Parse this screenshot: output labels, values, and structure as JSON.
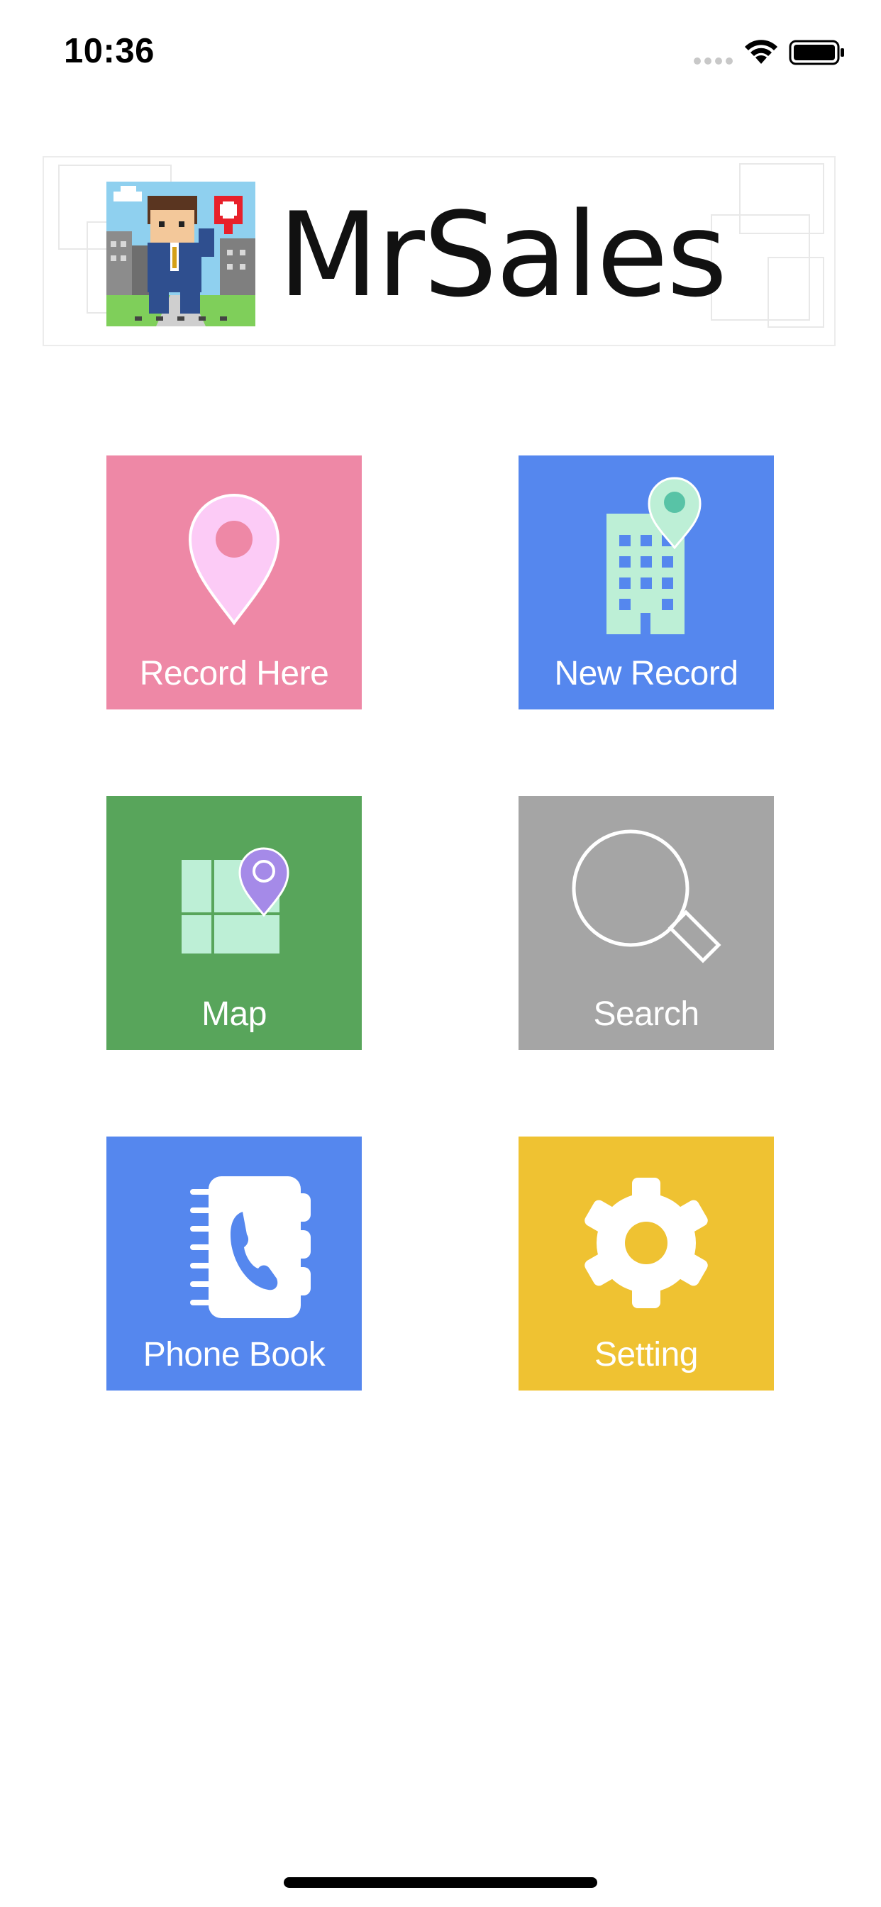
{
  "status_bar": {
    "time": "10:36"
  },
  "logo": {
    "text": "MrSales"
  },
  "tiles": [
    {
      "label": "Record Here",
      "icon": "location-pin-icon",
      "color": "#EE88A6"
    },
    {
      "label": "New Record",
      "icon": "building-pin-icon",
      "color": "#5587EE"
    },
    {
      "label": "Map",
      "icon": "map-pin-icon",
      "color": "#58A55B"
    },
    {
      "label": "Search",
      "icon": "magnifier-icon",
      "color": "#A5A5A5"
    },
    {
      "label": "Phone Book",
      "icon": "phone-book-icon",
      "color": "#5587EE"
    },
    {
      "label": "Setting",
      "icon": "gear-icon",
      "color": "#EFC232"
    }
  ]
}
